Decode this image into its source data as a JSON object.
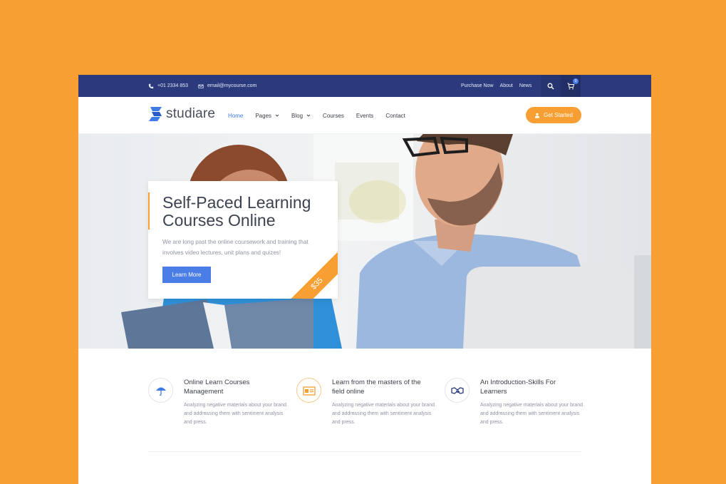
{
  "colors": {
    "background": "#F79F32",
    "topbar": "#2B3A7C",
    "accent": "#3E7BE6",
    "orange": "#F79F32"
  },
  "topbar": {
    "phone": "+01 2334 853",
    "email": "email@mycourse.com",
    "links": [
      "Purchase Now",
      "About",
      "News"
    ],
    "cart_count": "0"
  },
  "brand": {
    "name": "studiare"
  },
  "nav": {
    "items": [
      {
        "label": "Home",
        "active": true
      },
      {
        "label": "Pages",
        "dropdown": true
      },
      {
        "label": "Blog",
        "dropdown": true
      },
      {
        "label": "Courses"
      },
      {
        "label": "Events"
      },
      {
        "label": "Contact"
      }
    ],
    "cta": "Get Started"
  },
  "hero": {
    "title_line1": "Self-Paced Learning",
    "title_line2": "Courses Online",
    "text": "We are long past the online coursework and training that involves video lectures, unit plans and quizes!",
    "button": "Learn More",
    "price": "$35"
  },
  "features": [
    {
      "icon": "umbrella-icon",
      "title": "Online Learn Courses Management",
      "text": "Analyzing negative materials about your brand and addressing them with sentiment analysis and press."
    },
    {
      "icon": "id-card-icon",
      "title": "Learn from the masters of the field online",
      "text": "Analyzing negative materials about your brand and addressing them with sentiment analysis and press."
    },
    {
      "icon": "handshake-icon",
      "title": "An Introduction-Skills For Learners",
      "text": "Analyzing negative materials about your brand and addressing them with sentiment analysis and press."
    }
  ]
}
